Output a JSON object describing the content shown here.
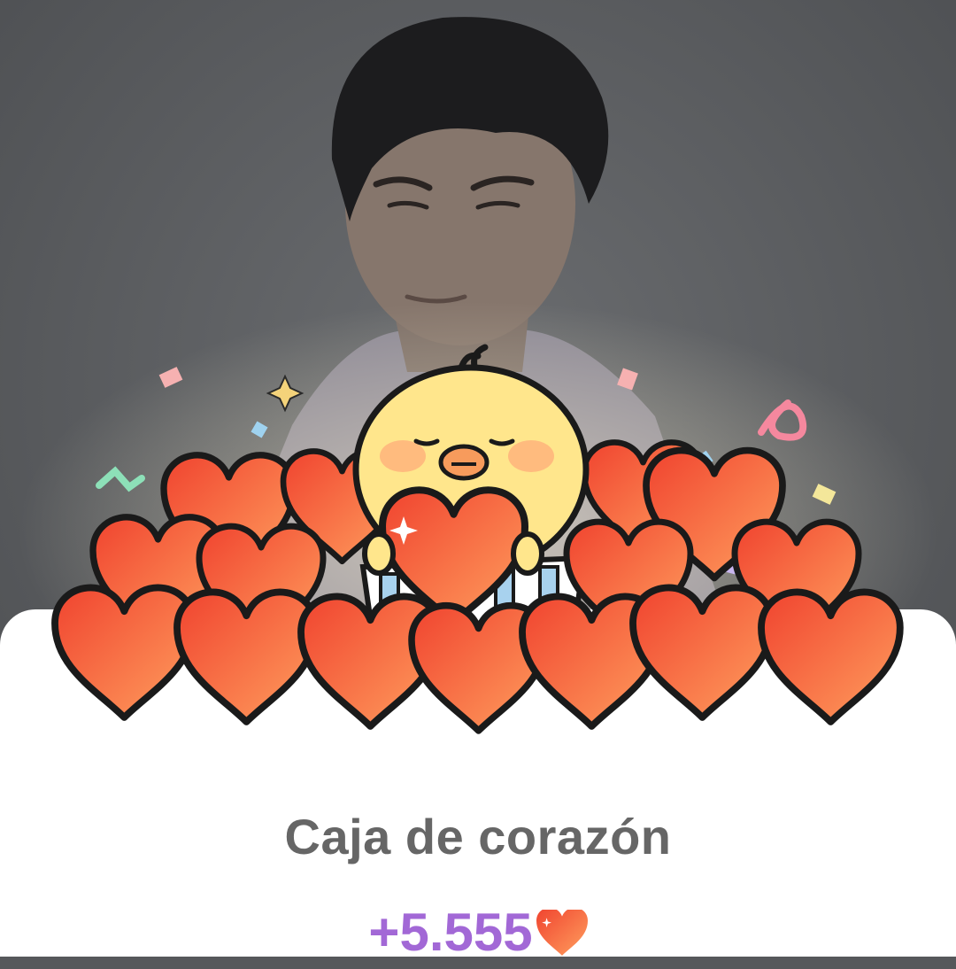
{
  "reward": {
    "title": "Caja de corazón",
    "amount": "+5.555"
  },
  "icons": {
    "amount_icon": "heart-icon",
    "mascot": "chick-holding-heart"
  },
  "colors": {
    "background_dim": "#56585b",
    "sheet": "#ffffff",
    "title_text": "#666666",
    "amount_text": "#a268d6",
    "heart_fill": "#f2543c",
    "heart_highlight": "#ff9a5c",
    "chick_body": "#ffe58a",
    "chick_beak": "#f79b5c"
  }
}
